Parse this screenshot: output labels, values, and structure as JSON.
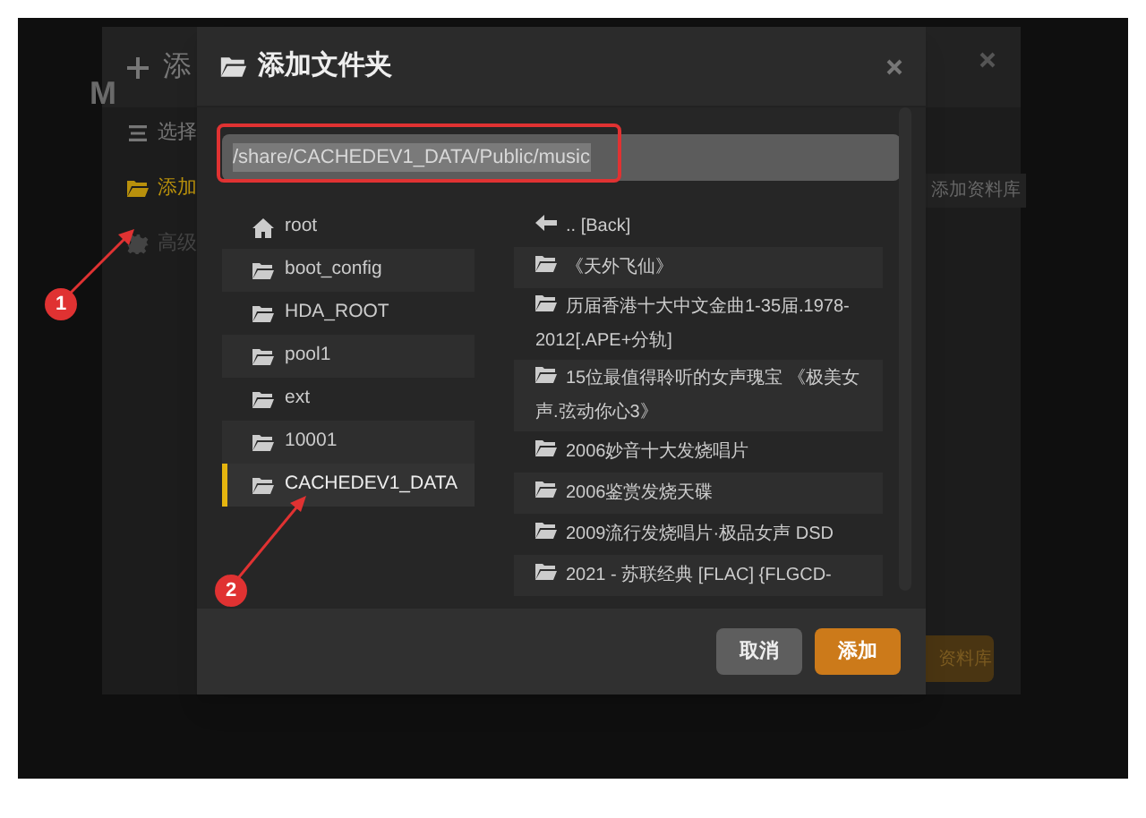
{
  "background_dialog": {
    "letter": "M",
    "title": "添",
    "side_items": [
      {
        "label": "选择",
        "kind": "list",
        "selected": false
      },
      {
        "label": "添加",
        "kind": "folder",
        "selected": true
      },
      {
        "label": "高级",
        "kind": "gear",
        "selected": false
      }
    ],
    "right_label": "添加资料库",
    "button": "资料库"
  },
  "dialog": {
    "title": "添加文件夹",
    "path": "/share/CACHEDEV1_DATA/Public/music",
    "left_items": [
      {
        "label": "root",
        "kind": "home",
        "selected": false
      },
      {
        "label": "boot_config",
        "kind": "folder",
        "selected": false
      },
      {
        "label": "HDA_ROOT",
        "kind": "folder",
        "selected": false
      },
      {
        "label": "pool1",
        "kind": "folder",
        "selected": false
      },
      {
        "label": "ext",
        "kind": "folder",
        "selected": false
      },
      {
        "label": "10001",
        "kind": "folder",
        "selected": false
      },
      {
        "label": "CACHEDEV1_DATA",
        "kind": "folder",
        "selected": true
      }
    ],
    "right_items": [
      {
        "label": ".. [Back]",
        "kind": "back"
      },
      {
        "label": "《天外飞仙》",
        "kind": "folder"
      },
      {
        "label": "历届香港十大中文金曲1-35届.1978-2012[.APE+分轨]",
        "kind": "folder"
      },
      {
        "label": "15位最值得聆听的女声瑰宝 《极美女声.弦动你心3》",
        "kind": "folder"
      },
      {
        "label": "2006妙音十大发烧唱片",
        "kind": "folder"
      },
      {
        "label": "2006鉴赏发烧天碟",
        "kind": "folder"
      },
      {
        "label": "2009流行发烧唱片·极品女声 DSD",
        "kind": "folder"
      },
      {
        "label": "2021 - 苏联经典 [FLAC] {FLGCD-",
        "kind": "folder"
      }
    ],
    "buttons": [
      {
        "label": "取消",
        "kind": "secondary"
      },
      {
        "label": "添加",
        "kind": "primary"
      }
    ]
  },
  "annotations": [
    {
      "label": "1"
    },
    {
      "label": "2"
    }
  ]
}
